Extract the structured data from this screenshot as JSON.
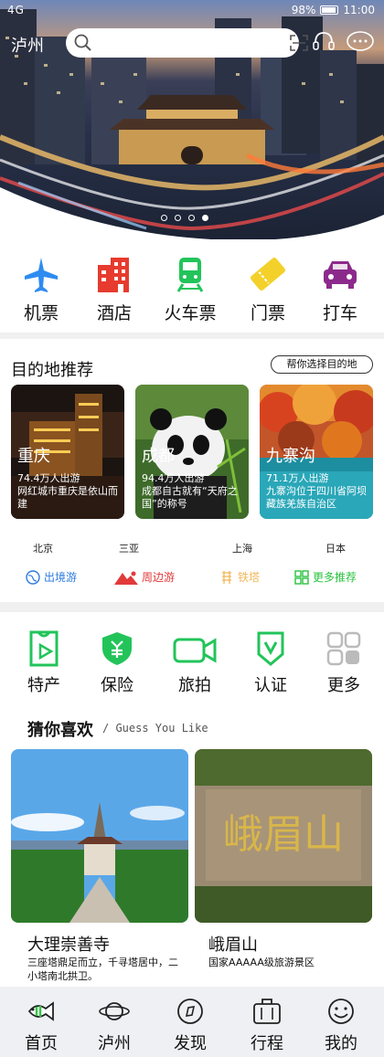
{
  "status": {
    "signal": "4G",
    "battery": "98%",
    "time": "11:00"
  },
  "header": {
    "city": "泸州",
    "search_placeholder": ""
  },
  "banner": {
    "page_count": 4,
    "active_index": 3
  },
  "quick_nav": [
    {
      "label": "机票",
      "icon": "airplane-icon",
      "color": "#2e8cf0"
    },
    {
      "label": "酒店",
      "icon": "hotel-icon",
      "color": "#e63b2e"
    },
    {
      "label": "火车票",
      "icon": "train-icon",
      "color": "#22c45a"
    },
    {
      "label": "门票",
      "icon": "ticket-icon",
      "color": "#f3d12a"
    },
    {
      "label": "打车",
      "icon": "taxi-icon",
      "color": "#8c2a8c"
    }
  ],
  "destinations": {
    "title": "目的地推荐",
    "help_button": "帮你选择目的地",
    "cards": [
      {
        "name": "重庆",
        "visitors": "74.4万人出游",
        "desc": "网红城市重庆是依山而建"
      },
      {
        "name": "成都",
        "visitors": "94.4万人出游",
        "desc": "成都自古就有“天府之国”的称号"
      },
      {
        "name": "九寨沟",
        "visitors": "71.1万人出游",
        "desc": "九寨沟位于四川省阿坝藏族羌族自治区"
      }
    ],
    "cities": [
      "北京",
      "三亚",
      "上海",
      "日本"
    ],
    "tags": [
      {
        "label": "出境游",
        "color": "#2e7be0",
        "icon": "globe-icon"
      },
      {
        "label": "周边游",
        "color": "#e23a3a",
        "icon": "mountain-icon"
      },
      {
        "label": "铁塔",
        "color": "#f0b85a",
        "icon": "tower-icon"
      },
      {
        "label": "更多推荐",
        "color": "#29c23e",
        "icon": "grid-icon"
      }
    ]
  },
  "services": [
    {
      "label": "特产",
      "icon": "specialty-icon"
    },
    {
      "label": "保险",
      "icon": "insurance-icon"
    },
    {
      "label": "旅拍",
      "icon": "camera-icon"
    },
    {
      "label": "认证",
      "icon": "certify-icon"
    },
    {
      "label": "更多",
      "icon": "more-icon"
    }
  ],
  "guess": {
    "title": "猜你喜欢",
    "subtitle": "/ Guess You Like",
    "items": [
      {
        "name": "大理崇善寺",
        "desc": "三座塔鼎足而立，千寻塔居中，二小塔南北拱卫。"
      },
      {
        "name": "峨眉山",
        "desc": "国家AAAAA级旅游景区",
        "rock_text": "峨眉山"
      }
    ]
  },
  "tabbar": [
    {
      "label": "首页",
      "icon": "fish-icon"
    },
    {
      "label": "泸州",
      "icon": "planet-icon"
    },
    {
      "label": "发现",
      "icon": "compass-icon"
    },
    {
      "label": "行程",
      "icon": "suitcase-icon"
    },
    {
      "label": "我的",
      "icon": "smile-icon"
    }
  ]
}
